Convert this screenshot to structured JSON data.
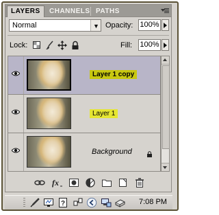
{
  "tabs": [
    {
      "label": "LAYERS",
      "active": true
    },
    {
      "label": "CHANNELS",
      "active": false
    },
    {
      "label": "PATHS",
      "active": false
    }
  ],
  "blend_mode": "Normal",
  "opacity": {
    "label": "Opacity:",
    "value": "100%"
  },
  "lock": {
    "label": "Lock:"
  },
  "fill": {
    "label": "Fill:",
    "value": "100%"
  },
  "layers": [
    {
      "name": "Layer 1 copy",
      "selected": true,
      "visible": true
    },
    {
      "name": "Layer 1",
      "selected": false,
      "visible": true
    },
    {
      "name": "Background",
      "selected": false,
      "visible": true,
      "locked": true
    }
  ],
  "colors": {
    "selection": "#b8b5c8",
    "highlight": "#e5e632",
    "panel": "#d6d3ce"
  },
  "taskbar": {
    "time": "7:08 PM"
  }
}
